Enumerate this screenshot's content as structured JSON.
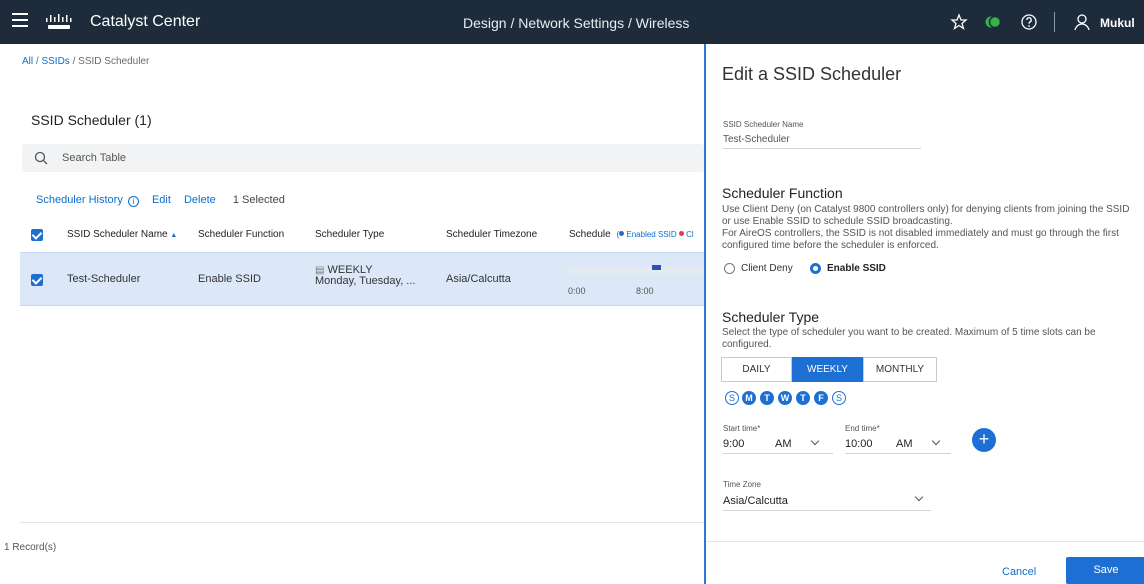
{
  "topbar": {
    "app_title": "Catalyst Center",
    "breadcrumb": "Design  /  Network Settings  /  Wireless",
    "user_name": "Mukul",
    "colors": {
      "background": "#1d2b3a",
      "status_green": "#35b34a"
    }
  },
  "page": {
    "breadcrumb": {
      "all": "All",
      "ssids": "SSIDs",
      "current": "SSID Scheduler",
      "separator": " / "
    },
    "section_title": "SSID Scheduler (1)",
    "search_placeholder": "Search Table",
    "actions": {
      "history": "Scheduler History",
      "edit": "Edit",
      "delete": "Delete",
      "selected": "1 Selected"
    },
    "columns": [
      "SSID Scheduler Name",
      "Scheduler Function",
      "Scheduler Type",
      "Scheduler Timezone",
      "Schedule"
    ],
    "schedule_legend": {
      "enabled": "Enabled SSID",
      "open_paren": "(",
      "next_initial": "Cl"
    },
    "sort_indicator": "▲",
    "rows": [
      {
        "name": "Test-Scheduler",
        "function": "Enable SSID",
        "type": "WEEKLY",
        "type_days": "Monday, Tuesday, ...",
        "timezone": "Asia/Calcutta",
        "ticks": [
          "0:00",
          "8:00"
        ],
        "selected": true
      }
    ],
    "records": "1 Record(s)"
  },
  "panel": {
    "title": "Edit a SSID Scheduler",
    "name_label": "SSID Scheduler Name",
    "name_value": "Test-Scheduler",
    "function_heading": "Scheduler Function",
    "function_desc_1": "Use Client Deny (on Catalyst 9800 controllers only) for denying clients from joining the SSID",
    "function_desc_2": "or use Enable SSID to schedule SSID broadcasting.",
    "function_desc_3": "For AireOS controllers, the SSID is not disabled immediately and must go through the first",
    "function_desc_4": "configured time before the scheduler is enforced.",
    "radio_client_deny": "Client Deny",
    "radio_enable_ssid": "Enable SSID",
    "type_heading": "Scheduler Type",
    "type_desc_1": "Select the type of scheduler you want to be created. Maximum of 5 time slots can be",
    "type_desc_2": "configured.",
    "tabs": [
      "DAILY",
      "WEEKLY",
      "MONTHLY"
    ],
    "active_tab": "WEEKLY",
    "days": [
      {
        "letter": "S",
        "on": false
      },
      {
        "letter": "M",
        "on": true
      },
      {
        "letter": "T",
        "on": true
      },
      {
        "letter": "W",
        "on": true
      },
      {
        "letter": "T",
        "on": true
      },
      {
        "letter": "F",
        "on": true
      },
      {
        "letter": "S",
        "on": false
      }
    ],
    "start_label": "Start time*",
    "start_time": "9:00",
    "start_ampm": "AM",
    "end_label": "End time*",
    "end_time": "10:00",
    "end_ampm": "AM",
    "add_icon": "+",
    "tz_label": "Time Zone",
    "tz_value": "Asia/Calcutta",
    "cancel": "Cancel",
    "save": "Save",
    "accent": "#1e6fd3"
  }
}
